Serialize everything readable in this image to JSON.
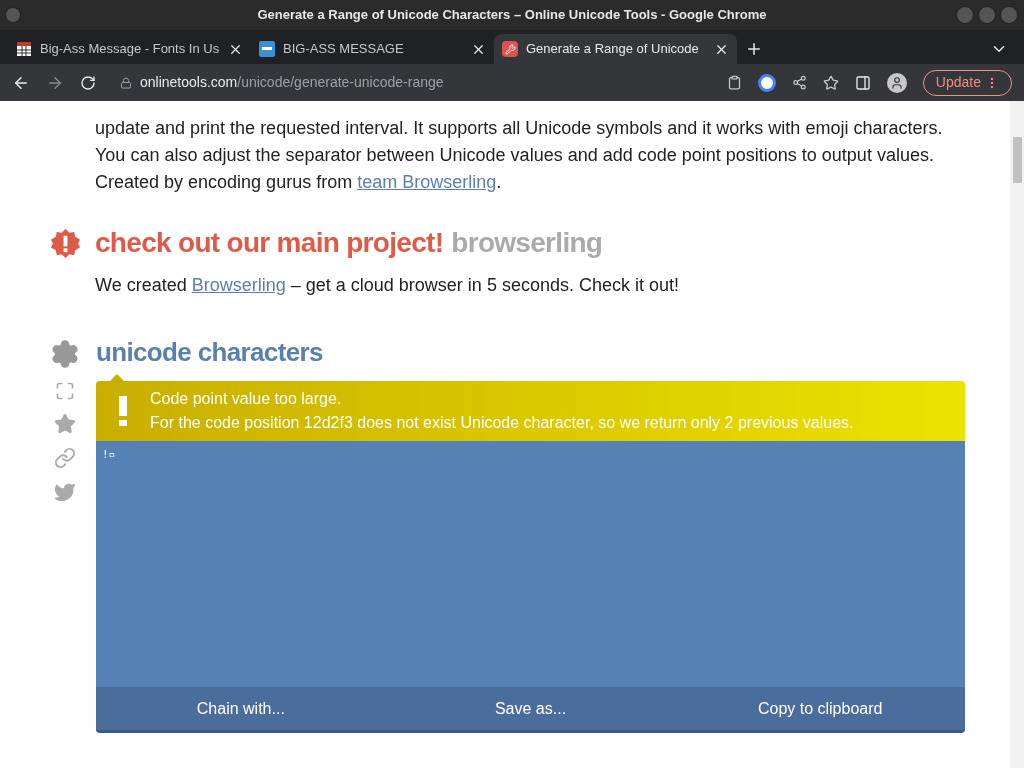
{
  "window": {
    "title": "Generate a Range of Unicode Characters – Online Unicode Tools - Google Chrome"
  },
  "tabs": [
    {
      "label": "Big-Ass Message - Fonts In Us",
      "selected": false
    },
    {
      "label": "BIG-ASS MESSAGE",
      "selected": false
    },
    {
      "label": "Generate a Range of Unicode",
      "selected": true
    }
  ],
  "address": {
    "host": "onlinetools.com",
    "path": "/unicode/generate-unicode-range"
  },
  "update_button": "Update",
  "intro": {
    "lines": [
      "update and print the requested interval. It supports all Unicode symbols and it works with emoji characters.",
      "You can also adjust the separator between Unicode values and add code point positions to output values."
    ],
    "last_prefix": "Created by encoding gurus from ",
    "last_link": "team Browserling",
    "last_suffix": "."
  },
  "project": {
    "title": "check out our main project!",
    "subtitle": "browserling",
    "prefix": "We created ",
    "link": "Browserling",
    "suffix": " – get a cloud browser in 5 seconds. Check it out!"
  },
  "tool": {
    "title": "unicode characters",
    "warning": {
      "title": "Code point value too large.",
      "message": "For the code position 12d2f3 does not exist Unicode character, so we return only 2 previous values."
    },
    "output": "!▫",
    "actions": [
      "Chain with...",
      "Save as...",
      "Copy to clipboard"
    ]
  }
}
